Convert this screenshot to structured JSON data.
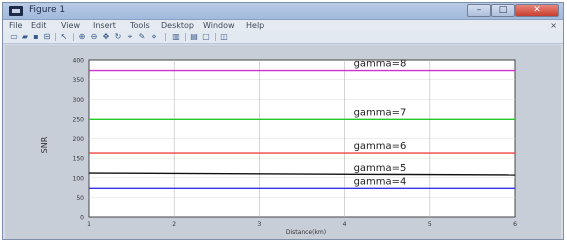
{
  "window": {
    "title": "Figure 1",
    "minimize": "–",
    "maximize": "□",
    "close": "✕"
  },
  "menu": {
    "items": [
      "File",
      "Edit",
      "View",
      "Insert",
      "Tools",
      "Desktop",
      "Window",
      "Help"
    ],
    "close_glyph": "×"
  },
  "toolbar": {
    "icons": [
      "new-file",
      "open-folder",
      "save",
      "print",
      "edit-plot",
      "zoom-in",
      "zoom-out",
      "pan",
      "rotate-3d",
      "data-cursor",
      "brush",
      "link-plot",
      "colorbar",
      "legend",
      "hide-plot-tools",
      "show-plot-tools"
    ]
  },
  "chart_data": {
    "type": "line",
    "title": "",
    "xlabel": "Distance(km)",
    "ylabel": "SNR",
    "xlim": [
      1,
      6
    ],
    "ylim": [
      0,
      400
    ],
    "x_ticks": [
      "1",
      "2",
      "3",
      "4",
      "5",
      "6"
    ],
    "y_ticks": [
      "0",
      "50",
      "100",
      "150",
      "200",
      "250",
      "300",
      "350",
      "400"
    ],
    "grid": true,
    "x": [
      1,
      6
    ],
    "series": [
      {
        "name": "gamma=8",
        "color": "#cc33cc",
        "values": [
          373,
          373
        ]
      },
      {
        "name": "gamma=7",
        "color": "#22cc22",
        "values": [
          249,
          249
        ]
      },
      {
        "name": "gamma=6",
        "color": "#ee4444",
        "values": [
          163,
          163
        ]
      },
      {
        "name": "gamma=5",
        "color": "#111111",
        "values": [
          112,
          107
        ]
      },
      {
        "name": "gamma=4",
        "color": "#3333ee",
        "values": [
          73,
          73
        ]
      }
    ]
  }
}
